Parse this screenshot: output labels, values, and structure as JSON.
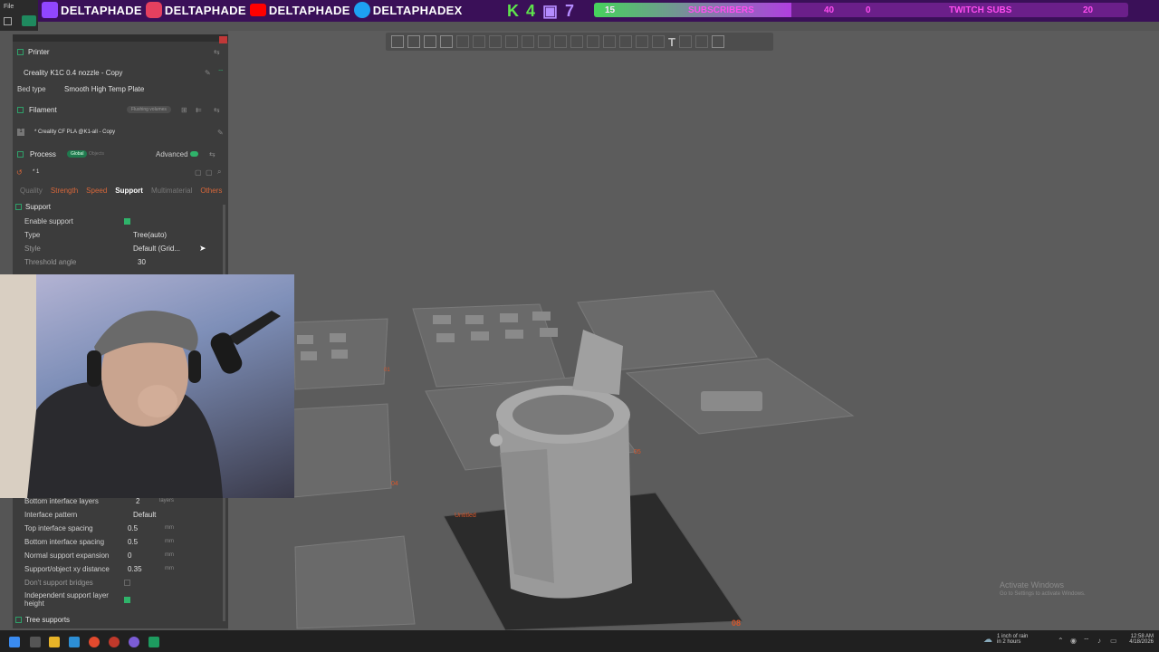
{
  "stream_overlay": {
    "social": [
      {
        "icon": "twitch-icon",
        "handle": "DELTAPHADE",
        "color": "#9146ff"
      },
      {
        "icon": "instagram-icon",
        "handle": "DELTAPHADE",
        "color": "#e4405f"
      },
      {
        "icon": "youtube-icon",
        "handle": "DELTAPHADE",
        "color": "#ff0000"
      },
      {
        "icon": "twitter-icon",
        "handle": "DELTAPHADEX",
        "color": "#1da1f2"
      }
    ],
    "kick_count": "4",
    "twitch_count": "7",
    "subs_current": "15",
    "subs_label": "SUBSCRIBERS",
    "subs_goal": "40",
    "twitch_subs_current": "0",
    "twitch_subs_label": "TWITCH SUBS",
    "twitch_subs_goal": "20",
    "subs_progress": 0.37
  },
  "window": {
    "menu_label": "File"
  },
  "printer": {
    "section_label": "Printer",
    "name": "Creality K1C 0.4 nozzle - Copy",
    "bed_label": "Bed type",
    "bed_value": "Smooth High Temp Plate"
  },
  "filament": {
    "section_label": "Filament",
    "flushing_label": "Flushing volumes",
    "slot": "1",
    "name": "* Creality CF PLA @K1-all - Copy"
  },
  "process": {
    "section_label": "Process",
    "global_label": "Global",
    "objects_label": "Objects",
    "advanced_label": "Advanced",
    "preset": "* 1"
  },
  "tabs": [
    "Quality",
    "Strength",
    "Speed",
    "Support",
    "Multimaterial",
    "Others"
  ],
  "support": {
    "section_label": "Support",
    "enable_label": "Enable support",
    "type_label": "Type",
    "type_value": "Tree(auto)",
    "style_label": "Style",
    "style_value": "Default (Grid...",
    "threshold_label": "Threshold angle",
    "threshold_value": "30"
  },
  "lower": {
    "bottom_layers_label": "Bottom interface layers",
    "bottom_layers_value": "2",
    "bottom_layers_unit": "layers",
    "pattern_label": "Interface pattern",
    "pattern_value": "Default",
    "top_spacing_label": "Top interface spacing",
    "top_spacing_value": "0.5",
    "top_spacing_unit": "mm",
    "bottom_spacing_label": "Bottom interface spacing",
    "bottom_spacing_value": "0.5",
    "bottom_spacing_unit": "mm",
    "expansion_label": "Normal support expansion",
    "expansion_value": "0",
    "expansion_unit": "mm",
    "xy_label": "Support/object xy distance",
    "xy_value": "0.35",
    "xy_unit": "mm",
    "bridges_label": "Don't support bridges",
    "independent_label": "Independent support layer height",
    "tree_label": "Tree supports"
  },
  "plates": {
    "p01": "01",
    "p04": "04",
    "p05": "05",
    "p08": "08",
    "untitled": "Untitled"
  },
  "watermark": {
    "title": "Activate Windows",
    "subtitle": "Go to Settings to activate Windows."
  },
  "taskbar": {
    "weather_line1": "1 inch of rain",
    "weather_line2": "in 2 hours",
    "time": "12:58 AM",
    "date": "4/18/2026"
  }
}
